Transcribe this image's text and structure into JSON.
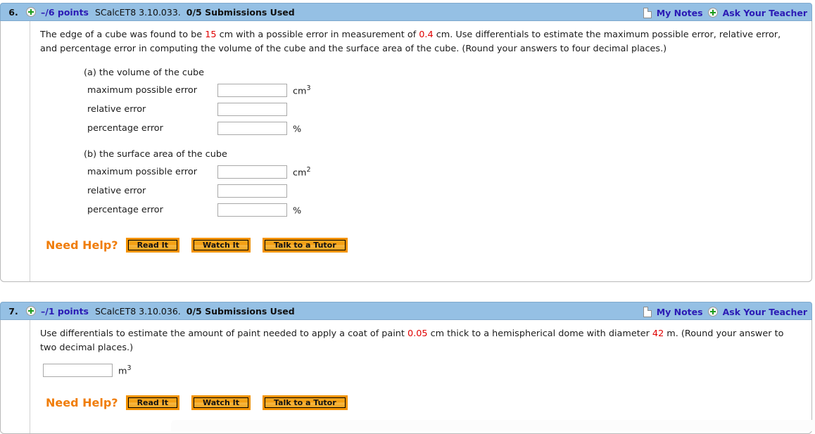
{
  "questions": [
    {
      "number": "6.",
      "points": "–/6 points",
      "code": "SCalcET8 3.10.033.",
      "submissions": "0/5 Submissions Used",
      "my_notes": "My Notes",
      "ask_teacher": "Ask Your Teacher",
      "stem": {
        "s1": "The edge of a cube was found to be ",
        "v1": "15",
        "s2": " cm with a possible error in measurement of ",
        "v2": "0.4",
        "s3": " cm. Use differentials to estimate the maximum possible error, relative error, and percentage error in computing the volume of the cube and the surface area of the cube. (Round your answers to four decimal places.)"
      },
      "parts": [
        {
          "label": "(a) the volume of the cube",
          "rows": [
            {
              "label": "maximum possible error",
              "value": "",
              "unit": "cm",
              "exp": "3"
            },
            {
              "label": "relative error",
              "value": "",
              "unit": "",
              "exp": ""
            },
            {
              "label": "percentage error",
              "value": "",
              "unit": "%",
              "exp": ""
            }
          ]
        },
        {
          "label": "(b) the surface area of the cube",
          "rows": [
            {
              "label": "maximum possible error",
              "value": "",
              "unit": "cm",
              "exp": "2"
            },
            {
              "label": "relative error",
              "value": "",
              "unit": "",
              "exp": ""
            },
            {
              "label": "percentage error",
              "value": "",
              "unit": "%",
              "exp": ""
            }
          ]
        }
      ],
      "need_help": {
        "label": "Need Help?",
        "read_it": "Read It",
        "watch_it": "Watch It",
        "talk_to_tutor": "Talk to a Tutor"
      }
    },
    {
      "number": "7.",
      "points": "–/1 points",
      "code": "SCalcET8 3.10.036.",
      "submissions": "0/5 Submissions Used",
      "my_notes": "My Notes",
      "ask_teacher": "Ask Your Teacher",
      "stem": {
        "s1": "Use differentials to estimate the amount of paint needed to apply a coat of paint ",
        "v1": "0.05",
        "s2": " cm thick to a hemispherical dome with diameter ",
        "v2": "42",
        "s3": " m. (Round your answer to two decimal places.)"
      },
      "answer": {
        "value": "",
        "unit": "m",
        "exp": "3"
      },
      "need_help": {
        "label": "Need Help?",
        "read_it": "Read It",
        "watch_it": "Watch It",
        "talk_to_tutor": "Talk to a Tutor"
      }
    }
  ],
  "colors": {
    "header_bar": "#95c0e4",
    "link": "#2b1bb5",
    "red_value": "#e00000",
    "need_help_orange": "#f07d0a",
    "button_orange": "#f39200"
  }
}
